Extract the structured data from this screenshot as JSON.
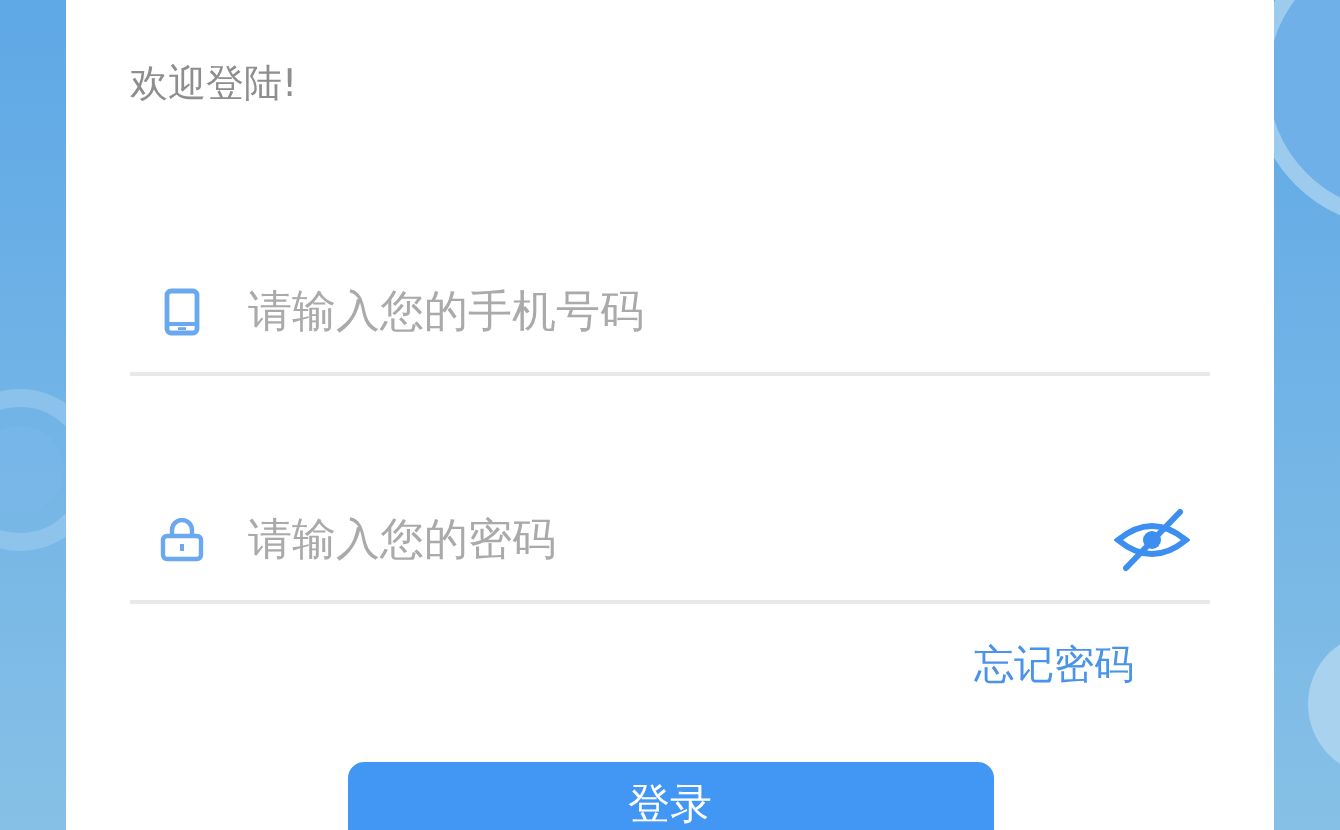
{
  "welcome": "欢迎登陆!",
  "fields": [
    {
      "kind": "phone",
      "placeholder": "请输入您的手机号码"
    },
    {
      "kind": "password",
      "placeholder": "请输入您的密码"
    }
  ],
  "forgot_link": "忘记密码",
  "login_button": "登录"
}
